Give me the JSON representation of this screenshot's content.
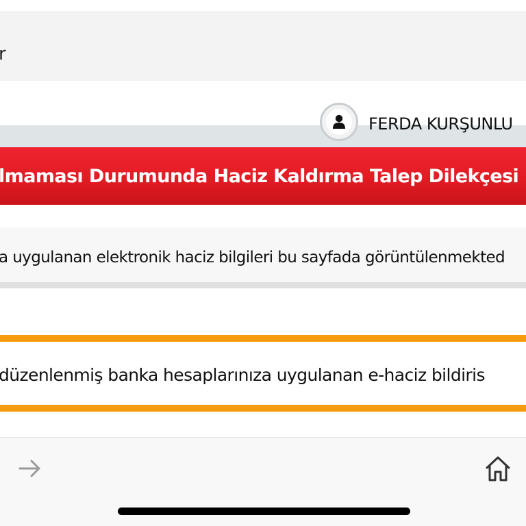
{
  "header": {
    "partial_title": "r"
  },
  "user": {
    "name": "FERDA KURŞUNLU",
    "avatar_icon": "user-icon"
  },
  "banner": {
    "title": "lmaması Durumunda Haciz Kaldırma Talep Dilekçesi",
    "color": "#e31b23"
  },
  "info": {
    "text": "a uygulanan elektronik haciz bilgileri bu sayfada görüntülenmekted"
  },
  "warning": {
    "text": "düzenlenmiş banka hesaplarınıza uygulanan e-haciz bildiris",
    "border_color": "#f69a0e"
  },
  "toolbar": {
    "forward_icon": "arrow-right-icon",
    "home_icon": "home-icon"
  }
}
